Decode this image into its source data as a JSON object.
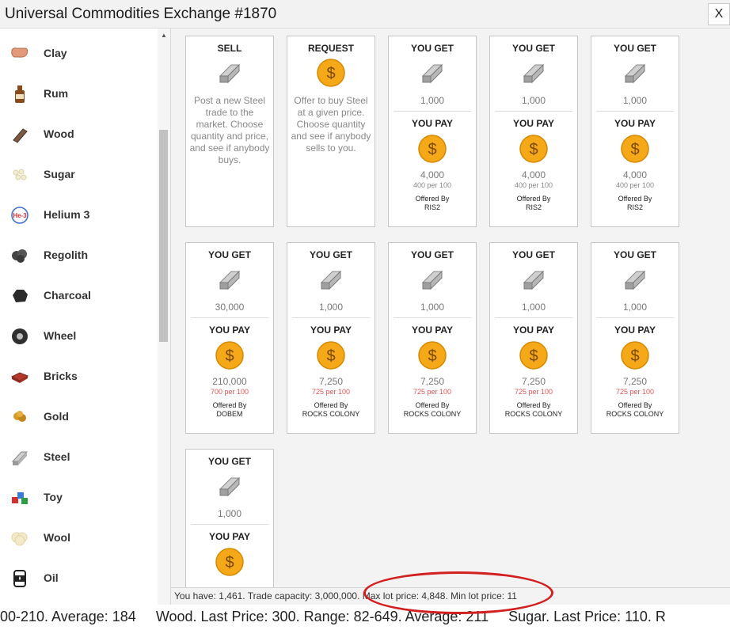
{
  "window": {
    "title": "Universal Commodities Exchange #1870",
    "close_label": "X"
  },
  "sidebar": {
    "items": [
      {
        "label": "Clay",
        "icon": "clay-icon",
        "color": "#e29a7a"
      },
      {
        "label": "Rum",
        "icon": "rum-bottle-icon",
        "color": "#8a4b1c"
      },
      {
        "label": "Wood",
        "icon": "wood-log-icon",
        "color": "#7a5a44"
      },
      {
        "label": "Sugar",
        "icon": "sugar-icon",
        "color": "#f3eed4"
      },
      {
        "label": "Helium 3",
        "icon": "helium3-icon",
        "color": "#d32f2f"
      },
      {
        "label": "Regolith",
        "icon": "regolith-icon",
        "color": "#444444"
      },
      {
        "label": "Charcoal",
        "icon": "charcoal-icon",
        "color": "#2b2b2b"
      },
      {
        "label": "Wheel",
        "icon": "wheel-icon",
        "color": "#2f2f2f"
      },
      {
        "label": "Bricks",
        "icon": "bricks-icon",
        "color": "#b33a2a"
      },
      {
        "label": "Gold",
        "icon": "gold-nugget-icon",
        "color": "#d39a27"
      },
      {
        "label": "Steel",
        "icon": "steel-ingot-icon",
        "color": "#9a9a9a"
      },
      {
        "label": "Toy",
        "icon": "toy-blocks-icon",
        "color": "#3a7bd5"
      },
      {
        "label": "Wool",
        "icon": "wool-icon",
        "color": "#f4e9c8"
      },
      {
        "label": "Oil",
        "icon": "oil-barrel-icon",
        "color": "#222222"
      }
    ]
  },
  "actions": {
    "sell": {
      "title": "SELL",
      "description": "Post a new Steel trade to the market. Choose quantity and price, and see if anybody buys."
    },
    "request": {
      "title": "REQUEST",
      "description": "Offer to buy Steel at a given price. Choose quantity and see if anybody sells to you."
    }
  },
  "offer_labels": {
    "get": "YOU GET",
    "pay": "YOU PAY",
    "offered_by": "Offered By"
  },
  "offers": [
    {
      "get_qty": "1,000",
      "pay_amount": "4,000",
      "per_unit": "400 per 100",
      "seller": "RIS2",
      "per_unit_highlight": false
    },
    {
      "get_qty": "1,000",
      "pay_amount": "4,000",
      "per_unit": "400 per 100",
      "seller": "RIS2",
      "per_unit_highlight": false
    },
    {
      "get_qty": "1,000",
      "pay_amount": "4,000",
      "per_unit": "400 per 100",
      "seller": "RIS2",
      "per_unit_highlight": false
    },
    {
      "get_qty": "30,000",
      "pay_amount": "210,000",
      "per_unit": "700 per 100",
      "seller": "DOBEM",
      "per_unit_highlight": true
    },
    {
      "get_qty": "1,000",
      "pay_amount": "7,250",
      "per_unit": "725 per 100",
      "seller": "ROCKS COLONY",
      "per_unit_highlight": true
    },
    {
      "get_qty": "1,000",
      "pay_amount": "7,250",
      "per_unit": "725 per 100",
      "seller": "ROCKS COLONY",
      "per_unit_highlight": true
    },
    {
      "get_qty": "1,000",
      "pay_amount": "7,250",
      "per_unit": "725 per 100",
      "seller": "ROCKS COLONY",
      "per_unit_highlight": true
    },
    {
      "get_qty": "1,000",
      "pay_amount": "7,250",
      "per_unit": "725 per 100",
      "seller": "ROCKS COLONY",
      "per_unit_highlight": true
    },
    {
      "get_qty": "1,000",
      "pay_amount": "",
      "per_unit": "",
      "seller": "",
      "per_unit_highlight": false
    }
  ],
  "status_bar": {
    "text": "You have: 1,461. Trade capacity: 3,000,000. Max lot price: 4,848. Min lot price: 11"
  },
  "ticker": {
    "text": "00-210. Average: 184     Wood. Last Price: 300. Range: 82-649. Average: 211     Sugar. Last Price: 110. R"
  },
  "colors": {
    "annotation": "#d21f1f",
    "coin": "#f5a818",
    "coin_text": "#7a4a00",
    "steel": "#a8a8a8",
    "per_unit_red": "#e05555"
  }
}
